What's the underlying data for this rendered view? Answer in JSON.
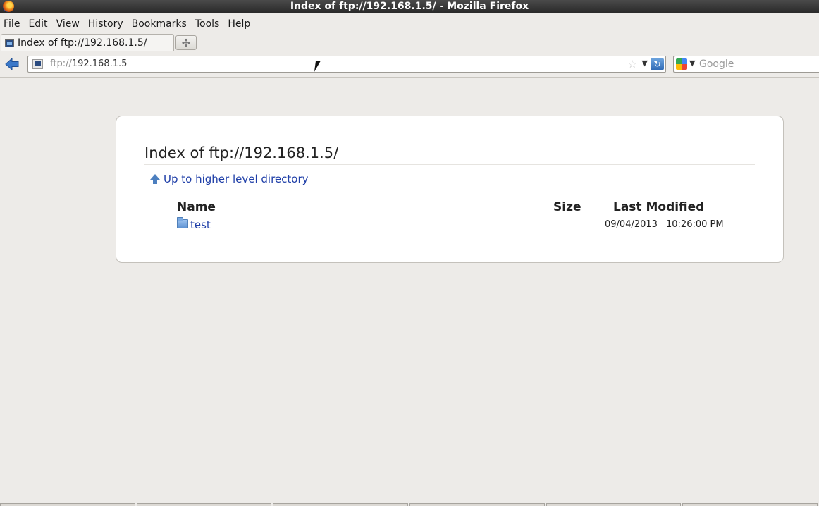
{
  "window": {
    "title": "Index of ftp://192.168.1.5/ - Mozilla Firefox"
  },
  "menubar": {
    "items": [
      {
        "label": "File"
      },
      {
        "label": "Edit"
      },
      {
        "label": "View"
      },
      {
        "label": "History"
      },
      {
        "label": "Bookmarks"
      },
      {
        "label": "Tools"
      },
      {
        "label": "Help"
      }
    ]
  },
  "tabs": [
    {
      "label": "Index of ftp://192.168.1.5/"
    }
  ],
  "newtab": {
    "symbol": "✣"
  },
  "navbar": {
    "url_protocol": "ftp://",
    "url_host": "192.168.1.5",
    "search_placeholder": "Google"
  },
  "page": {
    "title": "Index of ftp://192.168.1.5/",
    "up_link": "Up to higher level directory",
    "columns": {
      "name": "Name",
      "size": "Size",
      "modified": "Last Modified"
    },
    "rows": [
      {
        "name": "test",
        "size": "",
        "date": "09/04/2013",
        "time": "10:26:00 PM"
      }
    ]
  },
  "colors": {
    "link": "#1f3fa8",
    "panel_bg": "#ffffff",
    "page_bg": "#edebe8"
  }
}
